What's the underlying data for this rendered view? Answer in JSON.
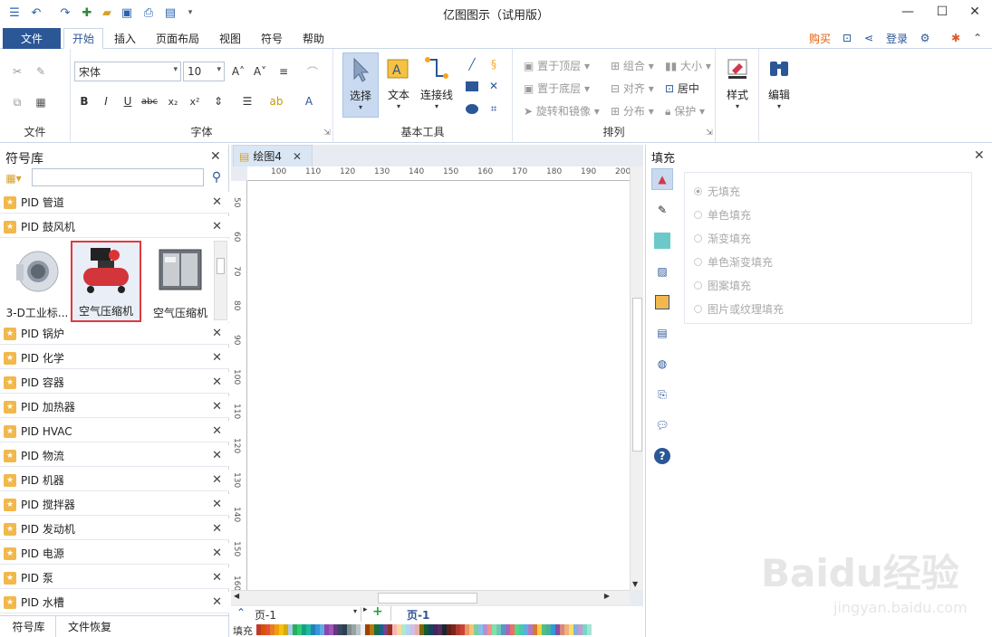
{
  "window": {
    "title": "亿图图示（试用版）"
  },
  "menu": {
    "file": "文件",
    "tabs": [
      "开始",
      "插入",
      "页面布局",
      "视图",
      "符号",
      "帮助"
    ],
    "active_tab": "开始",
    "buy": "购买",
    "login": "登录"
  },
  "ribbon": {
    "groups": {
      "file": "文件",
      "font": "字体",
      "basic_tools": "基本工具",
      "arrange": "排列"
    },
    "font_name": "宋体",
    "font_size": "10",
    "tools": {
      "select": "选择",
      "text": "文本",
      "connector": "连接线"
    },
    "arrange": {
      "bring_front": "置于顶层",
      "send_back": "置于底层",
      "rotate": "旋转和镜像",
      "group": "组合",
      "align": "对齐",
      "distribute": "分布",
      "size": "大小",
      "center": "居中",
      "protect": "保护"
    },
    "style": "样式",
    "edit": "编辑"
  },
  "library": {
    "title": "符号库",
    "search_placeholder": "",
    "items_top": [
      "PID 管道",
      "PID 鼓风机"
    ],
    "shapes": [
      "3-D工业标...",
      "空气压缩机",
      "空气压缩机"
    ],
    "selected_shape": 1,
    "items_bottom": [
      "PID 锅炉",
      "PID 化学",
      "PID 容器",
      "PID 加热器",
      "PID HVAC",
      "PID 物流",
      "PID 机器",
      "PID 搅拌器",
      "PID 发动机",
      "PID 电源",
      "PID 泵",
      "PID 水槽"
    ],
    "bottom_tabs": [
      "符号库",
      "文件恢复"
    ]
  },
  "canvas": {
    "doc_tab": "绘图4",
    "hruler_ticks": [
      "100",
      "110",
      "120",
      "130",
      "140",
      "150",
      "160",
      "170",
      "180",
      "190",
      "200"
    ],
    "vruler_ticks": [
      "50",
      "60",
      "70",
      "80",
      "90",
      "100",
      "110",
      "120",
      "130",
      "140",
      "150",
      "160"
    ]
  },
  "pagebar": {
    "page_select": "页-1",
    "page_tab": "页-1"
  },
  "palette": {
    "label": "填充"
  },
  "fill_panel": {
    "title": "填充",
    "options": [
      "无填充",
      "单色填充",
      "渐变填充",
      "单色渐变填充",
      "图案填充",
      "图片或纹理填充"
    ],
    "selected": 0
  },
  "watermark": {
    "main": "Baidu经验",
    "sub": "jingyan.baidu.com"
  },
  "colors": {
    "accent": "#2b5797",
    "buy": "#e65c00",
    "selection": "#e0393e",
    "palette": [
      "#c0392b",
      "#d35400",
      "#e74c3c",
      "#e67e22",
      "#f39c12",
      "#f1c40f",
      "#d4ac0d",
      "#a9cce3",
      "#27ae60",
      "#2ecc71",
      "#16a085",
      "#1abc9c",
      "#2980b9",
      "#3498db",
      "#5dade2",
      "#8e44ad",
      "#9b59b6",
      "#6c3483",
      "#34495e",
      "#2c3e50",
      "#7f8c8d",
      "#95a5a6",
      "#bdc3c7",
      "#ecf0f1",
      "#a04000",
      "#b9770e",
      "#196f3d",
      "#1f618d",
      "#76448a",
      "#943126",
      "#f5b7b1",
      "#fad7a0",
      "#abebc6",
      "#aed6f1",
      "#d7bde2",
      "#e6b0aa",
      "#7d6608",
      "#145a32",
      "#154360",
      "#4a235a",
      "#512e5f",
      "#1b2631",
      "#641e16",
      "#78281f",
      "#b03a2e",
      "#cb4335",
      "#e59866",
      "#f8c471",
      "#7dcea0",
      "#85c1e9",
      "#bb8fce",
      "#f1948a",
      "#82e0aa",
      "#73c6b6",
      "#5499c7",
      "#a569bd",
      "#ec7063",
      "#58d68d",
      "#48c9b0",
      "#5dade2",
      "#af7ac5",
      "#dc7633",
      "#f4d03f",
      "#52be80",
      "#45b39d",
      "#3498db",
      "#884ea0",
      "#d98880",
      "#f0b27a",
      "#f7dc6f",
      "#7fb3d5",
      "#c39bd3",
      "#76d7c4",
      "#a3e4d7"
    ]
  }
}
